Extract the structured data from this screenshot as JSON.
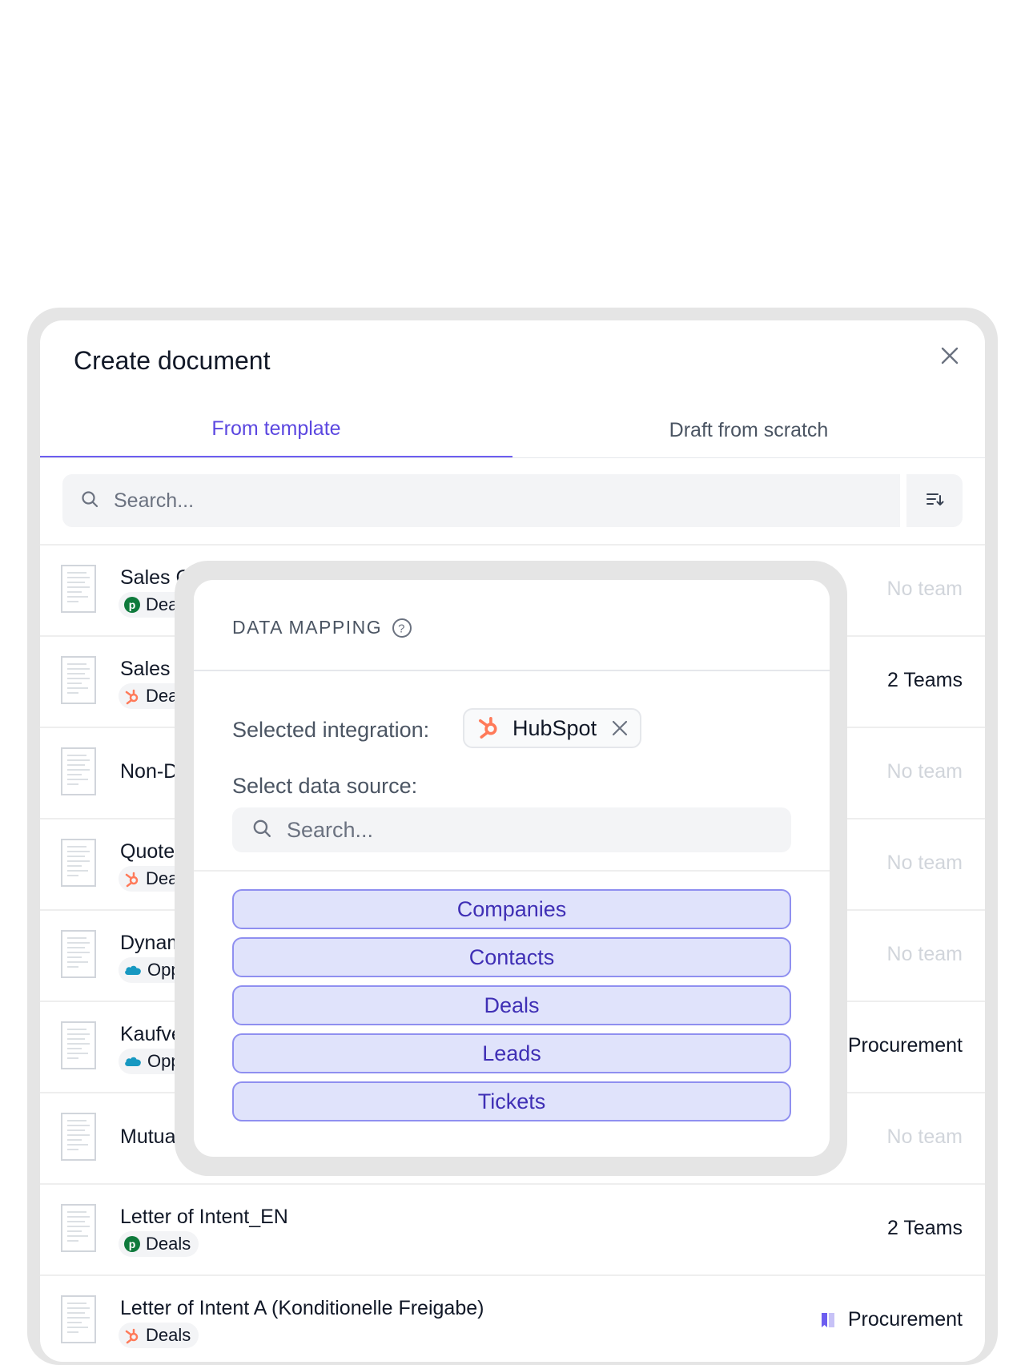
{
  "dialog": {
    "title": "Create document",
    "close_icon": "close-icon"
  },
  "tabs": [
    {
      "label": "From template",
      "active": true
    },
    {
      "label": "Draft from scratch",
      "active": false
    }
  ],
  "search": {
    "placeholder": "Search...",
    "icon": "search-icon",
    "sort_icon": "sort-icon"
  },
  "templates": [
    {
      "title": "Sales Contract (Goods)",
      "integration_icon": "pipedrive-icon",
      "source": "Deals",
      "team": "No team",
      "team_muted": true
    },
    {
      "title": "Sales Co",
      "integration_icon": "hubspot-icon",
      "source": "Deals",
      "team": "2 Teams",
      "team_muted": false
    },
    {
      "title": "Non-Dis",
      "integration_icon": null,
      "source": null,
      "team": "No team",
      "team_muted": true
    },
    {
      "title": "Quote",
      "integration_icon": "hubspot-icon",
      "source": "Deals",
      "team": "No team",
      "team_muted": true
    },
    {
      "title": "Dynami",
      "integration_icon": "salesforce-icon",
      "source": "Oppor",
      "team": "No team",
      "team_muted": true
    },
    {
      "title": "Kaufver",
      "integration_icon": "salesforce-icon",
      "source": "Oppor",
      "team": "Procurement",
      "team_muted": false
    },
    {
      "title": "Mutual I",
      "integration_icon": null,
      "source": null,
      "team": "No team",
      "team_muted": true
    },
    {
      "title": "Letter of Intent_EN",
      "integration_icon": "pipedrive-icon",
      "source": "Deals",
      "team": "2 Teams",
      "team_muted": false
    },
    {
      "title": "Letter of Intent A (Konditionelle Freigabe)",
      "integration_icon": "hubspot-icon",
      "source": "Deals",
      "team": "Procurement",
      "team_muted": false,
      "team_icon": "book-icon"
    }
  ],
  "data_mapping": {
    "header": "DATA MAPPING",
    "help_icon": "help-icon",
    "selected_integration_label": "Selected integration:",
    "integration_name": "HubSpot",
    "integration_icon": "hubspot-icon",
    "remove_icon": "close-icon",
    "data_source_label": "Select data source:",
    "search_placeholder": "Search...",
    "options": [
      "Companies",
      "Contacts",
      "Deals",
      "Leads",
      "Tickets"
    ]
  },
  "colors": {
    "accent": "#5b47e0",
    "option_bg": "#e0e3fb",
    "option_border": "#8f8ff0",
    "hubspot": "#ff7a59",
    "pipedrive": "#0f7a3c",
    "salesforce": "#1798c1"
  }
}
